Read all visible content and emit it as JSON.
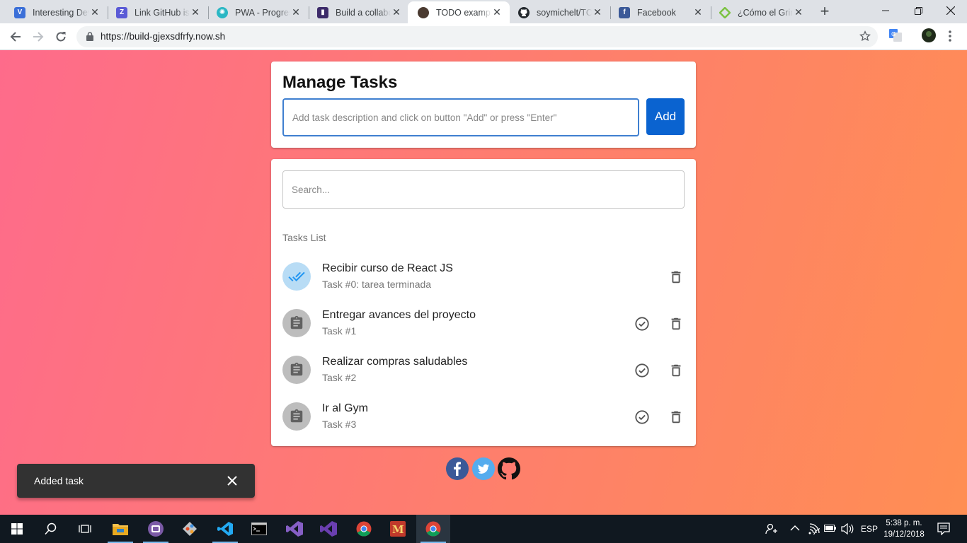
{
  "browser": {
    "tabs": [
      {
        "title": "Interesting Dev",
        "favicon": "vk-icon",
        "color": "#3b6fd8",
        "active": false
      },
      {
        "title": "Link GitHub iss",
        "favicon": "zenhub-icon",
        "color": "#5a5ad6",
        "active": false
      },
      {
        "title": "PWA - Progres",
        "favicon": "pwa-icon",
        "color": "#2ab7c4",
        "active": false
      },
      {
        "title": "Build a collabo",
        "favicon": "bookmark-icon",
        "color": "#3d2b6a",
        "active": false
      },
      {
        "title": "TODO example",
        "favicon": "avatar-icon",
        "color": "#4a3a30",
        "active": true
      },
      {
        "title": "soymichelt/TO",
        "favicon": "github-icon",
        "color": "#24292e",
        "active": false
      },
      {
        "title": "Facebook",
        "favicon": "facebook-icon",
        "color": "#3b5998",
        "active": false
      },
      {
        "title": "¿Cómo el Grin",
        "favicon": "diamond-icon",
        "color": "#7cc242",
        "active": false
      }
    ],
    "url": "https://build-gjexsdfrfy.now.sh"
  },
  "app": {
    "title": "Manage Tasks",
    "task_input_placeholder": "Add task description and click on button \"Add\" or press \"Enter\"",
    "add_label": "Add",
    "search_placeholder": "Search...",
    "list_title": "Tasks List",
    "tasks": [
      {
        "title": "Recibir curso de React JS",
        "subtitle": "Task #0: tarea terminada",
        "done": true
      },
      {
        "title": "Entregar avances del proyecto",
        "subtitle": "Task #1",
        "done": false
      },
      {
        "title": "Realizar compras saludables",
        "subtitle": "Task #2",
        "done": false
      },
      {
        "title": "Ir al Gym",
        "subtitle": "Task #3",
        "done": false
      }
    ],
    "social": [
      "facebook-icon",
      "twitter-icon",
      "github-icon"
    ],
    "snackbar_message": "Added task"
  },
  "colors": {
    "gradient_start": "#fe6b8b",
    "gradient_end": "#ff8e53",
    "primary_button": "#0a63d0",
    "done_avatar": "#b8dcf5"
  },
  "taskbar": {
    "language": "ESP",
    "time": "5:38 p. m.",
    "date": "19/12/2018"
  }
}
